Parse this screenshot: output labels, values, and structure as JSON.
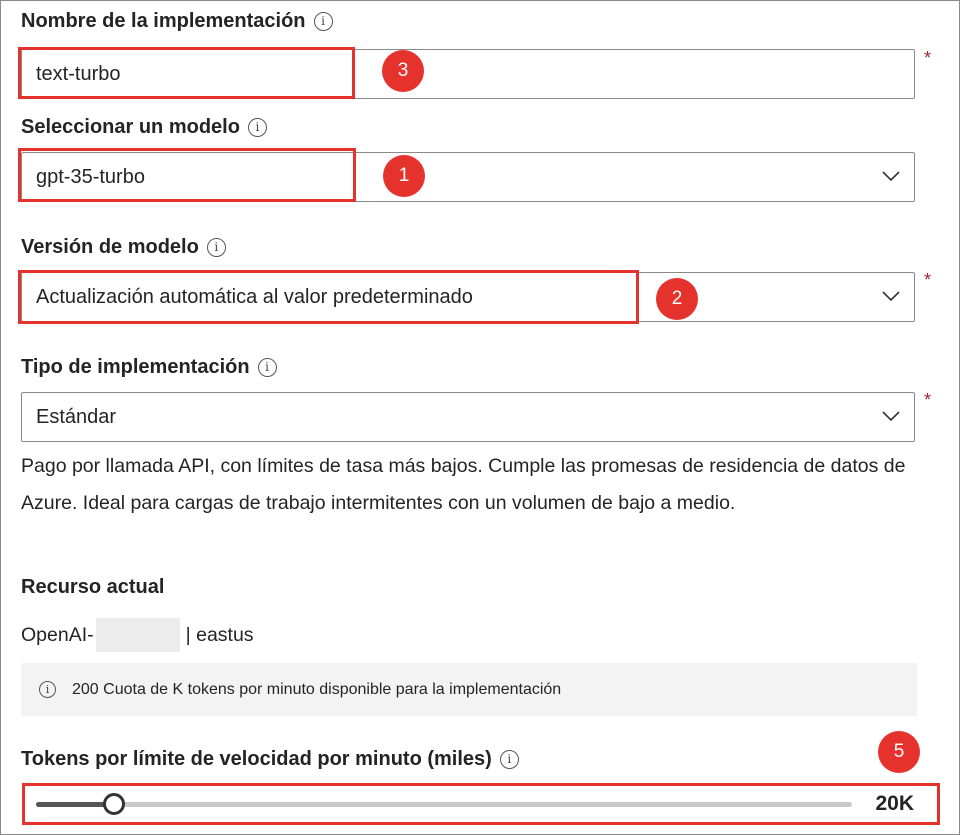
{
  "deployment_name": {
    "label": "Nombre de la implementación",
    "value": "text-turbo",
    "required": "*"
  },
  "model": {
    "label": "Seleccionar un modelo",
    "value": "gpt-35-turbo"
  },
  "model_version": {
    "label": "Versión de modelo",
    "value": "Actualización automática al valor predeterminado",
    "required": "*"
  },
  "deployment_type": {
    "label": "Tipo de implementación",
    "value": "Estándar",
    "required": "*",
    "description": "Pago por llamada API, con límites de tasa más bajos. Cumple las promesas de residencia de datos de Azure. Ideal para cargas de trabajo intermitentes con un volumen de bajo a medio."
  },
  "current_resource": {
    "label": "Recurso actual",
    "prefix": "OpenAI-",
    "suffix": "| eastus"
  },
  "quota_info": "200 Cuota de K tokens por minuto disponible para la implementación",
  "rate_limit": {
    "label": "Tokens por límite de velocidad por minuto (miles)",
    "value_label": "20K",
    "fraction": 0.095
  },
  "annotations": {
    "badge_1": "1",
    "badge_2": "2",
    "badge_3": "3",
    "badge_5": "5"
  },
  "colors": {
    "annotation": "#e5322d",
    "required": "#a4262c",
    "text": "#242424",
    "info_bar": "#f3f3f3"
  },
  "icons": {
    "info": "info-circle-icon",
    "dropdown": "chevron-down-icon"
  }
}
